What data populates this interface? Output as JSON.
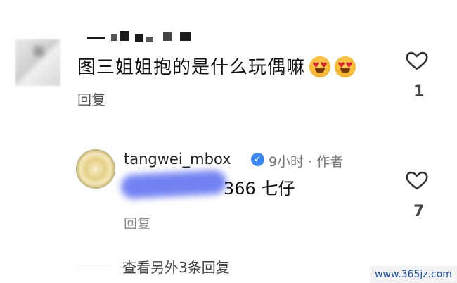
{
  "comment": {
    "text": "图三姐姐抱的是什么玩偶嘛",
    "emoji": "heart-eyes-emoji",
    "reply_label": "回复",
    "likes": "1"
  },
  "reply": {
    "username": "tangwei_mbox",
    "verified_icon": "check",
    "meta": "9小时 · 作者",
    "visible_text": "366 七仔",
    "reply_label": "回复",
    "likes": "7"
  },
  "thread": {
    "view_more": "查看另外3条回复"
  },
  "watermark": "www.365jz.com",
  "colors": {
    "verified": "#3a88f5",
    "watermark_text": "#1b4fa8"
  }
}
